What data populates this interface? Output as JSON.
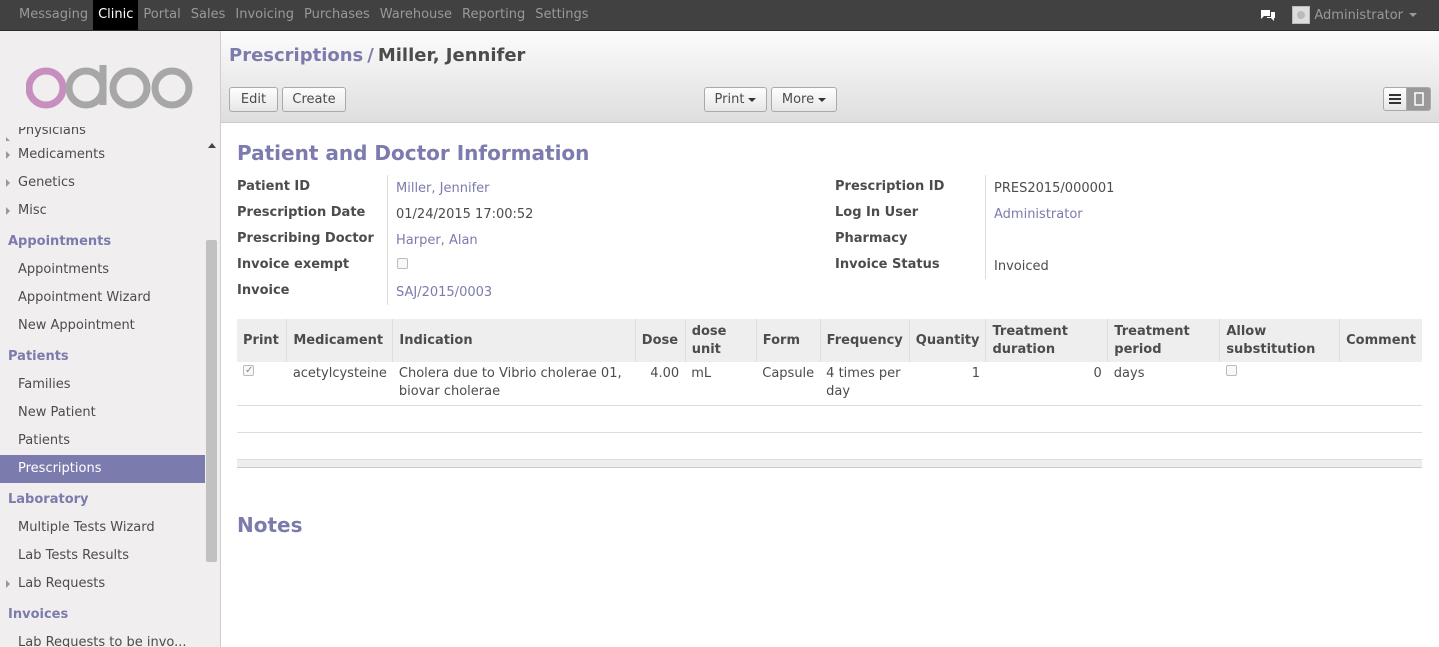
{
  "topbar": {
    "menu": [
      "Messaging",
      "Clinic",
      "Portal",
      "Sales",
      "Invoicing",
      "Purchases",
      "Warehouse",
      "Reporting",
      "Settings"
    ],
    "active": "Clinic",
    "user": "Administrator"
  },
  "sidebar": {
    "logo": "odoo",
    "partial_top_item": "Physicians",
    "items_top": [
      "Medicaments",
      "Genetics",
      "Misc"
    ],
    "appointments": {
      "title": "Appointments",
      "items": [
        "Appointments",
        "Appointment Wizard",
        "New Appointment"
      ]
    },
    "patients": {
      "title": "Patients",
      "items": [
        "Families",
        "New Patient",
        "Patients",
        "Prescriptions"
      ]
    },
    "laboratory": {
      "title": "Laboratory",
      "items": [
        "Multiple Tests Wizard",
        "Lab Tests Results",
        "Lab Requests"
      ]
    },
    "invoices": {
      "title": "Invoices",
      "partial_item": "Lab Requests to be invo..."
    }
  },
  "header": {
    "breadcrumb_parent": "Prescriptions",
    "breadcrumb_sep": "/",
    "breadcrumb_current": "Miller, Jennifer",
    "edit": "Edit",
    "create": "Create",
    "print": "Print",
    "more": "More"
  },
  "form": {
    "section_title": "Patient and Doctor Information",
    "patient_id_label": "Patient ID",
    "patient_id": "Miller, Jennifer",
    "prescription_date_label": "Prescription Date",
    "prescription_date": "01/24/2015 17:00:52",
    "doctor_label": "Prescribing Doctor",
    "doctor": "Harper, Alan",
    "invoice_exempt_label": "Invoice exempt",
    "invoice_label": "Invoice",
    "invoice": "SAJ/2015/0003",
    "prescription_id_label": "Prescription ID",
    "prescription_id": "PRES2015/000001",
    "login_user_label": "Log In User",
    "login_user": "Administrator",
    "pharmacy_label": "Pharmacy",
    "invoice_status_label": "Invoice Status",
    "invoice_status": "Invoiced",
    "notes_title": "Notes"
  },
  "lines": {
    "headers": [
      "Print",
      "Medicament",
      "Indication",
      "Dose",
      "dose unit",
      "Form",
      "Frequency",
      "Quantity",
      "Treatment duration",
      "Treatment period",
      "Allow substitution",
      "Comment"
    ],
    "row": {
      "print": true,
      "medicament": "acetylcysteine",
      "indication": "Cholera due to Vibrio cholerae 01, biovar cholerae",
      "dose": "4.00",
      "dose_unit": "mL",
      "form": "Capsule",
      "frequency": "4 times per day",
      "quantity": "1",
      "duration": "0",
      "period": "days",
      "allow_substitution": false,
      "comment": ""
    }
  }
}
